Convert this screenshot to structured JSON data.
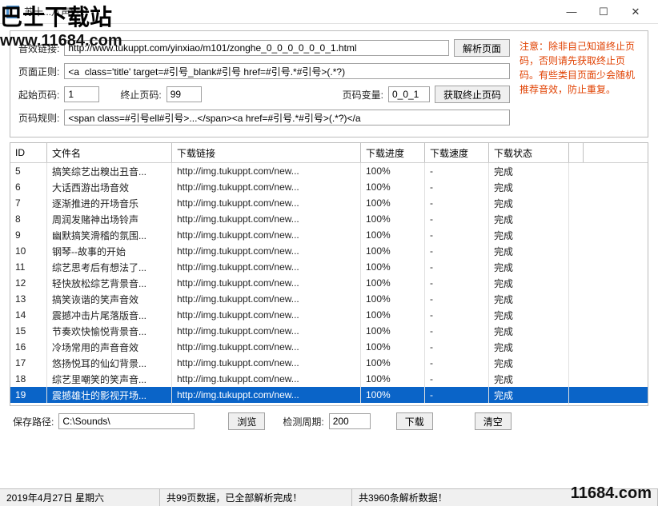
{
  "window": {
    "title": "苏十...八声>- :"
  },
  "watermark": {
    "line1": "巴士下载站",
    "line2": "www.11684.com",
    "bottom": "11684.com"
  },
  "form": {
    "link_label": "音效链接:",
    "link_value": "http://www.tukuppt.com/yinxiao/m101/zonghe_0_0_0_0_0_0_1.html",
    "link_btn": "解析页面",
    "regex_label": "页面正则:",
    "regex_value": "<a  class='title' target=#引号_blank#引号 href=#引号.*#引号>(.*?)",
    "start_label": "起始页码:",
    "start_value": "1",
    "end_label": "终止页码:",
    "end_value": "99",
    "var_label": "页码变量:",
    "var_value": "0_0_1",
    "var_btn": "获取终止页码",
    "rule_label": "页码规则:",
    "rule_value": "<span class=#引号ell#引号>...</span><a href=#引号.*#引号>(.*?)</a",
    "note": "注意：除非自己知道终止页码，否则请先获取终止页码。有些类目页面少会随机推荐音效，防止重复。"
  },
  "table": {
    "headers": {
      "id": "ID",
      "name": "文件名",
      "link": "下载链接",
      "prog": "下载进度",
      "speed": "下载速度",
      "stat": "下载状态"
    },
    "rows": [
      {
        "id": "5",
        "name": "搞笑综艺出糗出丑音...",
        "link": "http://img.tukuppt.com/new...",
        "prog": "100%",
        "speed": "-",
        "stat": "完成"
      },
      {
        "id": "6",
        "name": "大话西游出场音效",
        "link": "http://img.tukuppt.com/new...",
        "prog": "100%",
        "speed": "-",
        "stat": "完成"
      },
      {
        "id": "7",
        "name": "逐渐推进的开场音乐",
        "link": "http://img.tukuppt.com/new...",
        "prog": "100%",
        "speed": "-",
        "stat": "完成"
      },
      {
        "id": "8",
        "name": "周润发赌神出场铃声",
        "link": "http://img.tukuppt.com/new...",
        "prog": "100%",
        "speed": "-",
        "stat": "完成"
      },
      {
        "id": "9",
        "name": "幽默搞笑滑稽的氛围...",
        "link": "http://img.tukuppt.com/new...",
        "prog": "100%",
        "speed": "-",
        "stat": "完成"
      },
      {
        "id": "10",
        "name": "钢琴--故事的开始",
        "link": "http://img.tukuppt.com/new...",
        "prog": "100%",
        "speed": "-",
        "stat": "完成"
      },
      {
        "id": "11",
        "name": "综艺思考后有想法了...",
        "link": "http://img.tukuppt.com/new...",
        "prog": "100%",
        "speed": "-",
        "stat": "完成"
      },
      {
        "id": "12",
        "name": "轻快放松综艺背景音...",
        "link": "http://img.tukuppt.com/new...",
        "prog": "100%",
        "speed": "-",
        "stat": "完成"
      },
      {
        "id": "13",
        "name": "搞笑诙谐的笑声音效",
        "link": "http://img.tukuppt.com/new...",
        "prog": "100%",
        "speed": "-",
        "stat": "完成"
      },
      {
        "id": "14",
        "name": "震撼冲击片尾落版音...",
        "link": "http://img.tukuppt.com/new...",
        "prog": "100%",
        "speed": "-",
        "stat": "完成"
      },
      {
        "id": "15",
        "name": "节奏欢快愉悦背景音...",
        "link": "http://img.tukuppt.com/new...",
        "prog": "100%",
        "speed": "-",
        "stat": "完成"
      },
      {
        "id": "16",
        "name": "冷场常用的声音音效",
        "link": "http://img.tukuppt.com/new...",
        "prog": "100%",
        "speed": "-",
        "stat": "完成"
      },
      {
        "id": "17",
        "name": "悠扬悦耳的仙幻背景...",
        "link": "http://img.tukuppt.com/new...",
        "prog": "100%",
        "speed": "-",
        "stat": "完成"
      },
      {
        "id": "18",
        "name": "综艺里嘲笑的笑声音...",
        "link": "http://img.tukuppt.com/new...",
        "prog": "100%",
        "speed": "-",
        "stat": "完成"
      },
      {
        "id": "19",
        "name": "震撼雄壮的影视开场...",
        "link": "http://img.tukuppt.com/new...",
        "prog": "100%",
        "speed": "-",
        "stat": "完成",
        "sel": true
      }
    ]
  },
  "bottom": {
    "path_label": "保存路径:",
    "path_value": "C:\\Sounds\\",
    "browse": "浏览",
    "period_label": "检测周期:",
    "period_value": "200",
    "download": "下载",
    "clear": "清空"
  },
  "status": {
    "date": "2019年4月27日 星期六",
    "pages": "共99页数据，已全部解析完成！",
    "records": "共3960条解析数据！"
  }
}
